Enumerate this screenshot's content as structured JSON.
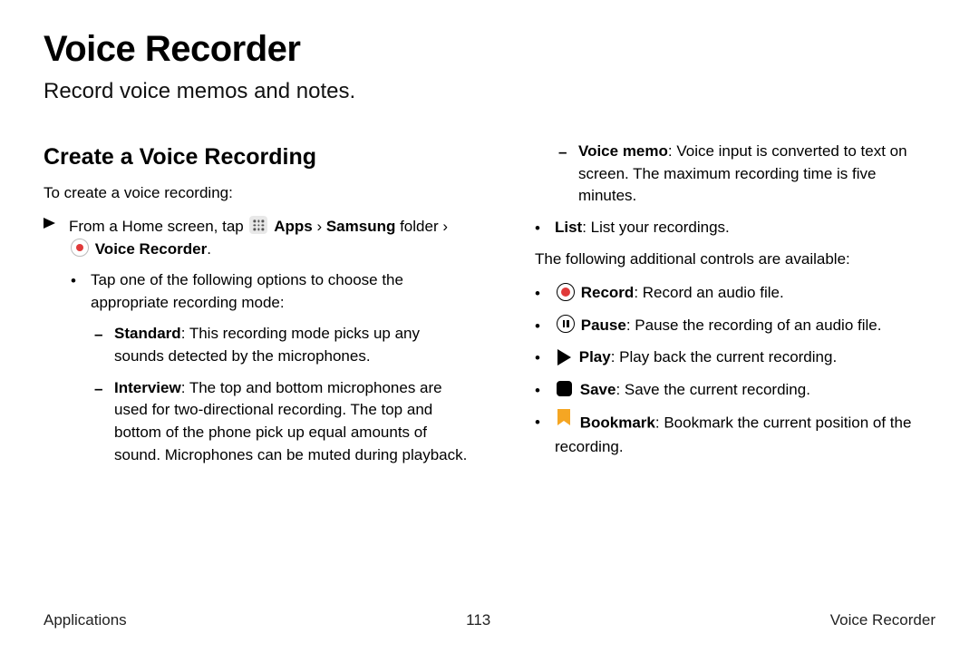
{
  "title": "Voice Recorder",
  "subtitle": "Record voice memos and notes.",
  "section": {
    "heading": "Create a Voice Recording",
    "intro": "To create a voice recording:"
  },
  "nav": {
    "prefix": "From a Home screen, tap",
    "apps_label": "Apps",
    "sep1": " › ",
    "samsung_label": "Samsung",
    "folder_text": " folder",
    "sep2": " › ",
    "vr_label": "Voice Recorder"
  },
  "modes_intro": "Tap one of the following options to choose the appropriate recording mode:",
  "modes": {
    "standard": {
      "name": "Standard",
      "desc": ": This recording mode picks up any sounds detected by the microphones."
    },
    "interview": {
      "name": "Interview",
      "desc": ": The top and bottom microphones are used for two-directional recording. The top and bottom of the phone pick up equal amounts of sound. Microphones can be muted during playback."
    },
    "voicememo": {
      "name": "Voice memo",
      "desc": ": Voice input is converted to text on screen. The maximum recording time is five minutes."
    }
  },
  "list_item": {
    "name": "List",
    "desc": ": List your recordings."
  },
  "controls_intro": "The following additional controls are available:",
  "controls": {
    "record": {
      "name": "Record",
      "desc": ": Record an audio file."
    },
    "pause": {
      "name": "Pause",
      "desc": ": Pause the recording of an audio file."
    },
    "play": {
      "name": "Play",
      "desc": ": Play back the current recording."
    },
    "save": {
      "name": "Save",
      "desc": ": Save the current recording."
    },
    "bookmark": {
      "name": "Bookmark",
      "desc": ": Bookmark the current position of the recording."
    }
  },
  "footer": {
    "left": "Applications",
    "center": "113",
    "right": "Voice Recorder"
  }
}
